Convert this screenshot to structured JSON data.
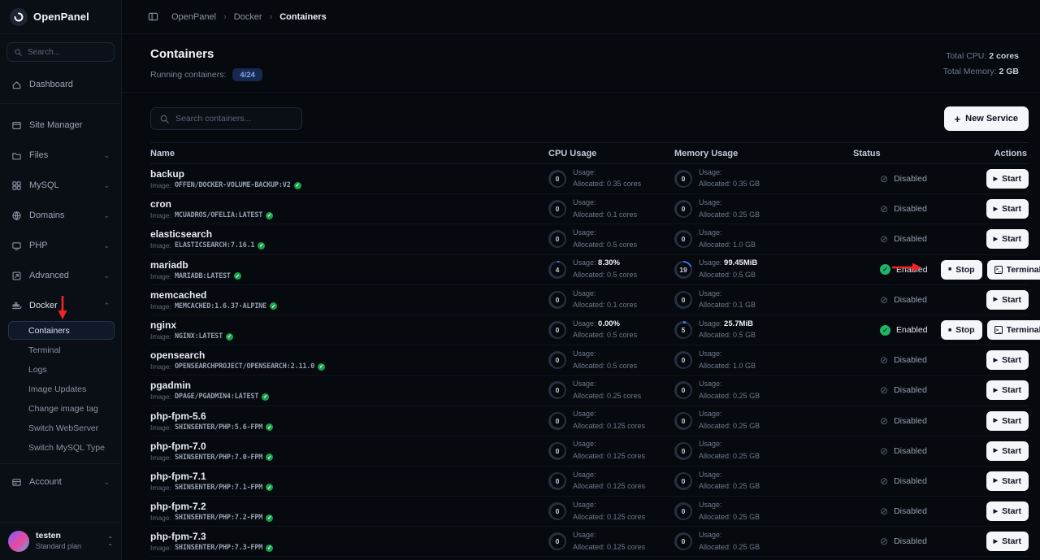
{
  "icons": {
    "chevron_down": "⌄",
    "chevron_up": "⌃",
    "breadcrumb_sep": "›",
    "plus": "+",
    "play": "▶",
    "stop": "■",
    "terminal": ">_",
    "check": "✓",
    "slash": "⊘",
    "select_up": "⌃",
    "select_down": "⌄"
  },
  "sidebar": {
    "logo": "OpenPanel",
    "search_placeholder": "Search...",
    "items": [
      {
        "label": "Dashboard",
        "icon": "home-icon",
        "divider_after": true
      },
      {
        "label": "Site Manager",
        "icon": "site-manager-icon"
      },
      {
        "label": "Files",
        "icon": "folder-icon",
        "chevron": "down"
      },
      {
        "label": "MySQL",
        "icon": "mysql-icon",
        "chevron": "down"
      },
      {
        "label": "Domains",
        "icon": "globe-icon",
        "chevron": "down"
      },
      {
        "label": "PHP",
        "icon": "php-icon",
        "chevron": "down"
      },
      {
        "label": "Advanced",
        "icon": "advanced-icon",
        "chevron": "down"
      },
      {
        "label": "Docker",
        "icon": "docker-icon",
        "chevron": "up",
        "expanded": true
      }
    ],
    "docker_submenu": [
      {
        "label": "Containers",
        "active": true
      },
      {
        "label": "Terminal"
      },
      {
        "label": "Logs"
      },
      {
        "label": "Image Updates"
      },
      {
        "label": "Change image tag"
      },
      {
        "label": "Switch WebServer"
      },
      {
        "label": "Switch MySQL Type"
      }
    ],
    "account_label": "Account",
    "user": {
      "name": "testen",
      "plan": "Standard plan"
    }
  },
  "breadcrumb": {
    "items": [
      "OpenPanel",
      "Docker",
      "Containers"
    ]
  },
  "header": {
    "title": "Containers",
    "running_label": "Running containers:",
    "running_badge": "4/24",
    "total_cpu_label": "Total CPU:",
    "total_cpu_value": "2 cores",
    "total_memory_label": "Total Memory:",
    "total_memory_value": "2 GB"
  },
  "toolbar": {
    "search_placeholder": "Search containers...",
    "new_service": "New Service"
  },
  "table": {
    "columns": [
      "Name",
      "CPU Usage",
      "Memory Usage",
      "Status",
      "Actions"
    ],
    "image_label": "Image:",
    "usage_label": "Usage:",
    "allocated_label": "Allocated:",
    "rows": [
      {
        "name": "backup",
        "image": "OFFEN/DOCKER-VOLUME-BACKUP:V2",
        "cpu": {
          "circle": "0",
          "usage": "",
          "allocated": "0.35 cores"
        },
        "mem": {
          "circle": "0",
          "usage": "",
          "allocated": "0.35 GB"
        },
        "status": "Disabled",
        "actions": [
          "Start"
        ]
      },
      {
        "name": "cron",
        "image": "MCUADROS/OFELIA:LATEST",
        "cpu": {
          "circle": "0",
          "usage": "",
          "allocated": "0.1 cores"
        },
        "mem": {
          "circle": "0",
          "usage": "",
          "allocated": "0.25 GB"
        },
        "status": "Disabled",
        "actions": [
          "Start"
        ]
      },
      {
        "name": "elasticsearch",
        "image": "ELASTICSEARCH:7.16.1",
        "cpu": {
          "circle": "0",
          "usage": "",
          "allocated": "0.5 cores"
        },
        "mem": {
          "circle": "0",
          "usage": "",
          "allocated": "1.0 GB"
        },
        "status": "Disabled",
        "actions": [
          "Start"
        ]
      },
      {
        "name": "mariadb",
        "image": "MARIADB:LATEST",
        "cpu": {
          "circle": "4",
          "usage": "8.30%",
          "allocated": "0.5 cores"
        },
        "mem": {
          "circle": "19",
          "usage": "99.45MiB",
          "allocated": "0.5 GB"
        },
        "status": "Enabled",
        "actions": [
          "Stop",
          "Terminal"
        ]
      },
      {
        "name": "memcached",
        "image": "MEMCACHED:1.6.37-ALPINE",
        "cpu": {
          "circle": "0",
          "usage": "",
          "allocated": "0.1 cores"
        },
        "mem": {
          "circle": "0",
          "usage": "",
          "allocated": "0.1 GB"
        },
        "status": "Disabled",
        "actions": [
          "Start"
        ]
      },
      {
        "name": "nginx",
        "image": "NGINX:LATEST",
        "cpu": {
          "circle": "0",
          "usage": "0.00%",
          "allocated": "0.5 cores"
        },
        "mem": {
          "circle": "5",
          "usage": "25.7MiB",
          "allocated": "0.5 GB"
        },
        "status": "Enabled",
        "actions": [
          "Stop",
          "Terminal"
        ]
      },
      {
        "name": "opensearch",
        "image": "OPENSEARCHPROJECT/OPENSEARCH:2.11.0",
        "cpu": {
          "circle": "0",
          "usage": "",
          "allocated": "0.5 cores"
        },
        "mem": {
          "circle": "0",
          "usage": "",
          "allocated": "1.0 GB"
        },
        "status": "Disabled",
        "actions": [
          "Start"
        ]
      },
      {
        "name": "pgadmin",
        "image": "DPAGE/PGADMIN4:LATEST",
        "cpu": {
          "circle": "0",
          "usage": "",
          "allocated": "0.25 cores"
        },
        "mem": {
          "circle": "0",
          "usage": "",
          "allocated": "0.25 GB"
        },
        "status": "Disabled",
        "actions": [
          "Start"
        ]
      },
      {
        "name": "php-fpm-5.6",
        "image": "SHINSENTER/PHP:5.6-FPM",
        "cpu": {
          "circle": "0",
          "usage": "",
          "allocated": "0.125 cores"
        },
        "mem": {
          "circle": "0",
          "usage": "",
          "allocated": "0.25 GB"
        },
        "status": "Disabled",
        "actions": [
          "Start"
        ]
      },
      {
        "name": "php-fpm-7.0",
        "image": "SHINSENTER/PHP:7.0-FPM",
        "cpu": {
          "circle": "0",
          "usage": "",
          "allocated": "0.125 cores"
        },
        "mem": {
          "circle": "0",
          "usage": "",
          "allocated": "0.25 GB"
        },
        "status": "Disabled",
        "actions": [
          "Start"
        ]
      },
      {
        "name": "php-fpm-7.1",
        "image": "SHINSENTER/PHP:7.1-FPM",
        "cpu": {
          "circle": "0",
          "usage": "",
          "allocated": "0.125 cores"
        },
        "mem": {
          "circle": "0",
          "usage": "",
          "allocated": "0.25 GB"
        },
        "status": "Disabled",
        "actions": [
          "Start"
        ]
      },
      {
        "name": "php-fpm-7.2",
        "image": "SHINSENTER/PHP:7.2-FPM",
        "cpu": {
          "circle": "0",
          "usage": "",
          "allocated": "0.125 cores"
        },
        "mem": {
          "circle": "0",
          "usage": "",
          "allocated": "0.25 GB"
        },
        "status": "Disabled",
        "actions": [
          "Start"
        ]
      },
      {
        "name": "php-fpm-7.3",
        "image": "SHINSENTER/PHP:7.3-FPM",
        "cpu": {
          "circle": "0",
          "usage": "",
          "allocated": "0.125 cores"
        },
        "mem": {
          "circle": "0",
          "usage": "",
          "allocated": "0.25 GB"
        },
        "status": "Disabled",
        "actions": [
          "Start"
        ]
      }
    ]
  }
}
